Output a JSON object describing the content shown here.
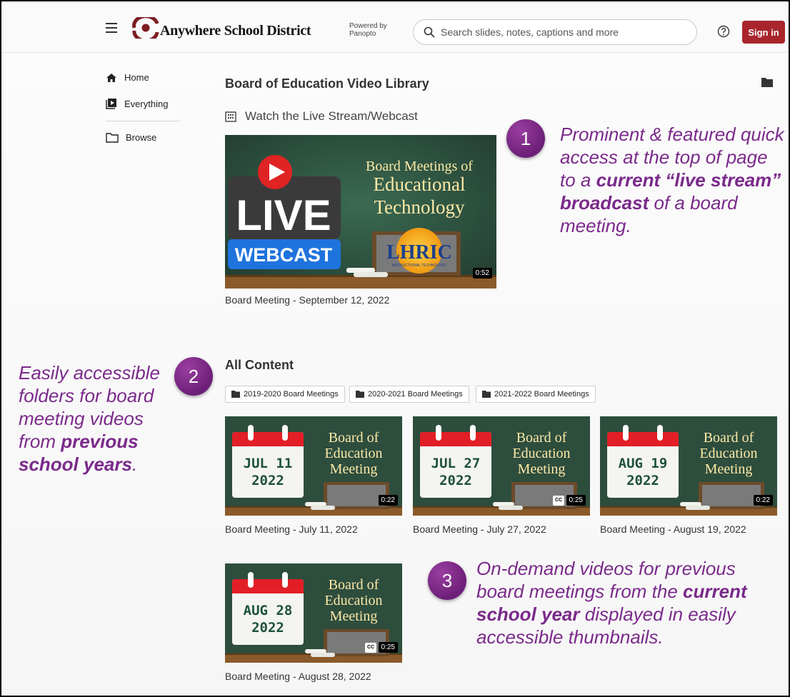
{
  "header": {
    "brand": "Anywhere School District",
    "powered_line1": "Powered by",
    "powered_line2": "Panopto",
    "search_placeholder": "Search slides, notes, captions and more",
    "sign_in": "Sign in"
  },
  "sidebar": {
    "items": [
      {
        "label": "Home",
        "icon": "home-icon"
      },
      {
        "label": "Everything",
        "icon": "play-library-icon"
      },
      {
        "label": "Browse",
        "icon": "folder-icon"
      }
    ]
  },
  "main": {
    "library_title": "Board of Education Video Library",
    "live_section": "Watch the Live Stream/Webcast",
    "featured": {
      "title": "Board Meeting - September 12, 2022",
      "duration": "0:52",
      "thumb_live": "LIVE",
      "thumb_webcast": "WEBCAST",
      "thumb_line1": "Board Meetings of",
      "thumb_line2": "Educational",
      "thumb_line3": "Technology",
      "thumb_logo": "LHRIC",
      "thumb_logo_sub": "INSTRUCTIONAL TECHNOLOGY"
    },
    "all_content": "All Content",
    "folders": [
      {
        "label": "2019-2020 Board Meetings"
      },
      {
        "label": "2020-2021 Board Meetings"
      },
      {
        "label": "2021-2022 Board Meetings"
      }
    ],
    "videos": [
      {
        "title": "Board Meeting - July 11, 2022",
        "month_day": "JUL 11",
        "year": "2022",
        "duration": "0:22",
        "cc": false
      },
      {
        "title": "Board Meeting - July 27, 2022",
        "month_day": "JUL 27",
        "year": "2022",
        "duration": "0:25",
        "cc": true
      },
      {
        "title": "Board Meeting - August 19, 2022",
        "month_day": "AUG 19",
        "year": "2022",
        "duration": "0:22",
        "cc": false
      },
      {
        "title": "Board Meeting - August 28, 2022",
        "month_day": "AUG 28",
        "year": "2022",
        "duration": "0:25",
        "cc": true
      }
    ],
    "thumb_text": {
      "line1": "Board of",
      "line2": "Education",
      "line3": "Meeting"
    },
    "cc_label": "CC"
  },
  "annotations": [
    {
      "number": "1",
      "pre1": "Prominent & featured quick access at the top of page to a ",
      "bold": "current “live stream” broadcast",
      "post": " of a board meeting."
    },
    {
      "number": "2",
      "pre1": "Easily accessible folders for board meeting videos from ",
      "bold": "previous school years",
      "post": "."
    },
    {
      "number": "3",
      "pre1": "On-demand videos for previous board meetings from the ",
      "bold": "current school year",
      "post": " displayed in easily accessible thumbnails."
    }
  ],
  "colors": {
    "accent": "#a8262b",
    "annotation": "#7a2a8a",
    "board": "#2c4d3c"
  }
}
